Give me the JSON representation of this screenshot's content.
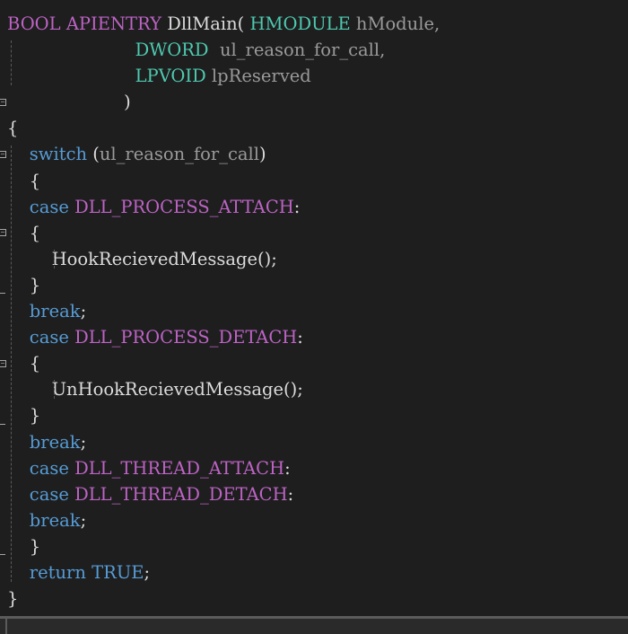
{
  "editor": {
    "lines": [
      [
        {
          "t": "BOOL ",
          "c": "macro"
        },
        {
          "t": "APIENTRY ",
          "c": "macro"
        },
        {
          "t": "DllMain( ",
          "c": "plain"
        },
        {
          "t": "HMODULE ",
          "c": "type"
        },
        {
          "t": "hModule,",
          "c": "param"
        }
      ],
      [
        {
          "t": "                       ",
          "c": "plain"
        },
        {
          "t": "DWORD  ",
          "c": "type"
        },
        {
          "t": "ul_reason_for_call,",
          "c": "param"
        }
      ],
      [
        {
          "t": "                       ",
          "c": "plain"
        },
        {
          "t": "LPVOID ",
          "c": "type"
        },
        {
          "t": "lpReserved",
          "c": "param"
        }
      ],
      [
        {
          "t": "                     )",
          "c": "plain"
        }
      ],
      [
        {
          "t": "{",
          "c": "plain"
        }
      ],
      [
        {
          "t": "    ",
          "c": "plain"
        },
        {
          "t": "switch",
          "c": "keyword"
        },
        {
          "t": " (",
          "c": "plain"
        },
        {
          "t": "ul_reason_for_call",
          "c": "param"
        },
        {
          "t": ")",
          "c": "plain"
        }
      ],
      [
        {
          "t": "    {",
          "c": "plain"
        }
      ],
      [
        {
          "t": "    ",
          "c": "plain"
        },
        {
          "t": "case ",
          "c": "keyword"
        },
        {
          "t": "DLL_PROCESS_ATTACH",
          "c": "macro"
        },
        {
          "t": ":",
          "c": "plain"
        }
      ],
      [
        {
          "t": "    {",
          "c": "plain"
        }
      ],
      [
        {
          "t": "        ",
          "c": "plain"
        },
        {
          "t": "HookRecievedMessage",
          "c": "func"
        },
        {
          "t": "();",
          "c": "plain"
        }
      ],
      [
        {
          "t": "    }",
          "c": "plain"
        }
      ],
      [
        {
          "t": "    ",
          "c": "plain"
        },
        {
          "t": "break",
          "c": "keyword"
        },
        {
          "t": ";",
          "c": "plain"
        }
      ],
      [
        {
          "t": "    ",
          "c": "plain"
        },
        {
          "t": "case ",
          "c": "keyword"
        },
        {
          "t": "DLL_PROCESS_DETACH",
          "c": "macro"
        },
        {
          "t": ":",
          "c": "plain"
        }
      ],
      [
        {
          "t": "    {",
          "c": "plain"
        }
      ],
      [
        {
          "t": "        ",
          "c": "plain"
        },
        {
          "t": "UnHookRecievedMessage",
          "c": "func"
        },
        {
          "t": "();",
          "c": "plain"
        }
      ],
      [
        {
          "t": "    }",
          "c": "plain"
        }
      ],
      [
        {
          "t": "    ",
          "c": "plain"
        },
        {
          "t": "break",
          "c": "keyword"
        },
        {
          "t": ";",
          "c": "plain"
        }
      ],
      [
        {
          "t": "    ",
          "c": "plain"
        },
        {
          "t": "case ",
          "c": "keyword"
        },
        {
          "t": "DLL_THREAD_ATTACH",
          "c": "macro"
        },
        {
          "t": ":",
          "c": "plain"
        }
      ],
      [
        {
          "t": "    ",
          "c": "plain"
        },
        {
          "t": "case ",
          "c": "keyword"
        },
        {
          "t": "DLL_THREAD_DETACH",
          "c": "macro"
        },
        {
          "t": ":",
          "c": "plain"
        }
      ],
      [
        {
          "t": "    ",
          "c": "plain"
        },
        {
          "t": "break",
          "c": "keyword"
        },
        {
          "t": ";",
          "c": "plain"
        }
      ],
      [
        {
          "t": "    }",
          "c": "plain"
        }
      ],
      [
        {
          "t": "    ",
          "c": "plain"
        },
        {
          "t": "return ",
          "c": "keyword"
        },
        {
          "t": "TRUE",
          "c": "keyword"
        },
        {
          "t": ";",
          "c": "plain"
        }
      ],
      [
        {
          "t": "}",
          "c": "plain"
        }
      ]
    ]
  },
  "colors": {
    "background": "#1e1e1e",
    "keyword": "#569cd6",
    "macro": "#bd63c5",
    "type": "#4ec9b0",
    "param": "#9a9a9a",
    "plain": "#dcdcdc"
  }
}
